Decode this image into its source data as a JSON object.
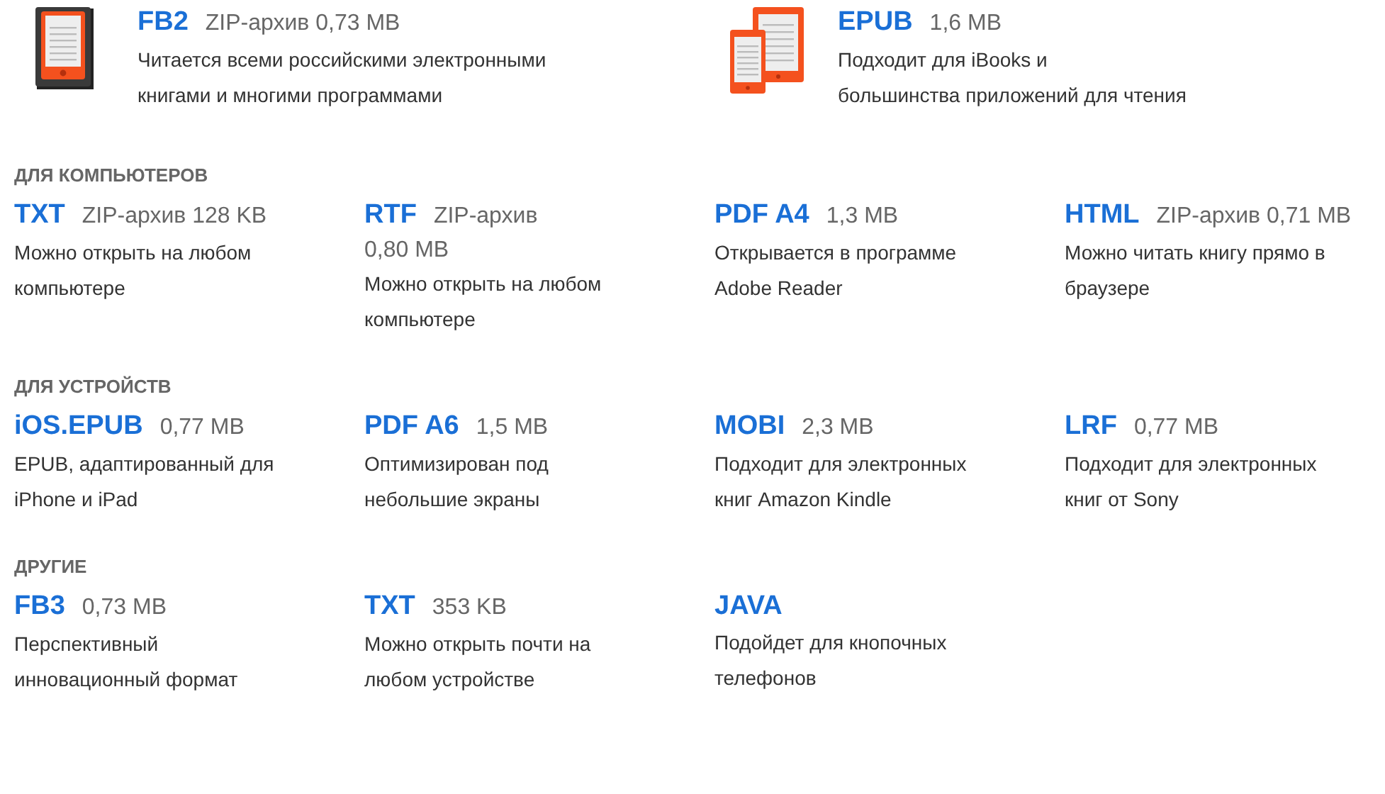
{
  "featured": [
    {
      "kind": "reader",
      "title": "FB2",
      "size": [
        "ZIP-архив 0,73 MB"
      ],
      "description": [
        "Читается всеми российскими электронными",
        "книгами и многими программами"
      ]
    },
    {
      "kind": "tablets",
      "title": "EPUB",
      "size": [
        "1,6 MB"
      ],
      "description": [
        "Подходит для iBooks и",
        "большинства приложений для чтения"
      ]
    }
  ],
  "sections": [
    {
      "heading": "ДЛЯ КОМПЬЮТЕРОВ",
      "formats": [
        {
          "title": "TXT",
          "size": [
            "ZIP-архив 128 KB"
          ],
          "description": [
            "Можно открыть на любом",
            "компьютере"
          ]
        },
        {
          "title": "RTF",
          "size": [
            "ZIP-архив",
            "0,80 MB"
          ],
          "description": [
            "Можно открыть на любом",
            "компьютере"
          ]
        },
        {
          "title": "PDF A4",
          "size": [
            "1,3 MB"
          ],
          "description": [
            "Открывается в программе",
            "Adobe Reader"
          ]
        },
        {
          "title": "HTML",
          "size": [
            "ZIP-архив 0,71 MB"
          ],
          "description": [
            "Можно читать книгу прямо в",
            "браузере"
          ]
        }
      ]
    },
    {
      "heading": "ДЛЯ УСТРОЙСТВ",
      "formats": [
        {
          "title": "iOS.EPUB",
          "size": [
            "0,77 MB"
          ],
          "description": [
            "EPUB, адаптированный для",
            "iPhone и iPad"
          ]
        },
        {
          "title": "PDF A6",
          "size": [
            "1,5 MB"
          ],
          "description": [
            "Оптимизирован под",
            "небольшие экраны"
          ]
        },
        {
          "title": "MOBI",
          "size": [
            "2,3 MB"
          ],
          "description": [
            "Подходит для электронных",
            "книг Amazon Kindle"
          ]
        },
        {
          "title": "LRF",
          "size": [
            "0,77 MB"
          ],
          "description": [
            "Подходит для электронных",
            "книг от Sony"
          ]
        }
      ]
    },
    {
      "heading": "ДРУГИЕ",
      "formats": [
        {
          "title": "FB3",
          "size": [
            "0,73 MB"
          ],
          "description": [
            "Перспективный",
            "инновационный формат"
          ]
        },
        {
          "title": "TXT",
          "size": [
            "353 KB"
          ],
          "description": [
            "Можно открыть почти на",
            "любом устройстве"
          ]
        },
        {
          "title": "JAVA",
          "description": [
            "Подойдет для кнопочных",
            "телефонов"
          ]
        }
      ]
    }
  ]
}
